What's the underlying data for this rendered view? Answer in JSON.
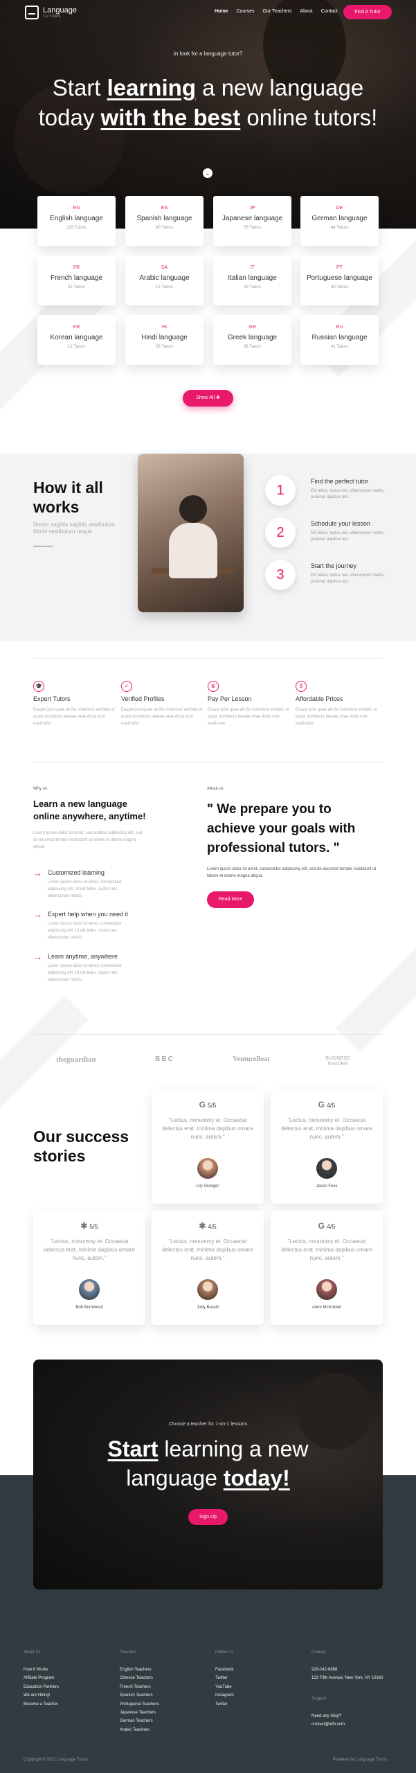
{
  "header": {
    "logo_title": "Language",
    "logo_subtitle": "TUTORS",
    "nav": [
      "Home",
      "Courses",
      "Our Teachers",
      "About",
      "Contact"
    ],
    "cta_label": "Find A Tutor"
  },
  "hero": {
    "kicker": "In look for a language tutor?",
    "title_1": "Start ",
    "title_bold_1": "learning",
    "title_2": " a new language today ",
    "title_bold_2": "with the best",
    "title_3": " online tutors!",
    "scroll_icon": "arrow-down-icon"
  },
  "languages": [
    {
      "code": "EN",
      "name": "English language",
      "count": "125 Tutors"
    },
    {
      "code": "ES",
      "name": "Spanish language",
      "count": "60 Tutors"
    },
    {
      "code": "JP",
      "name": "Japanese language",
      "count": "76 Tutors"
    },
    {
      "code": "DE",
      "name": "German language",
      "count": "44 Tutors"
    },
    {
      "code": "FR",
      "name": "French language",
      "count": "92 Tutors"
    },
    {
      "code": "SA",
      "name": "Arabic language",
      "count": "12 Tutors"
    },
    {
      "code": "IT",
      "name": "Italian language",
      "count": "40 Tutors"
    },
    {
      "code": "PT",
      "name": "Portuguese language",
      "count": "30 Tutors"
    },
    {
      "code": "KR",
      "name": "Korean language",
      "count": "12 Tutors"
    },
    {
      "code": "HI",
      "name": "Hindi language",
      "count": "28 Tutors"
    },
    {
      "code": "GR",
      "name": "Greek language",
      "count": "36 Tutors"
    },
    {
      "code": "RU",
      "name": "Russian language",
      "count": "41 Tutors"
    }
  ],
  "show_all": "Show All",
  "how": {
    "title": "How it all works",
    "subtitle": "Donec sagittis sagittis vestibulum. Morbi vestibulum neque",
    "steps": [
      {
        "num": "1",
        "title": "Find the perfect tutor",
        "text": "Elit tellus, luctus nec ullamcorper mattis, pulvinar dapibus leo."
      },
      {
        "num": "2",
        "title": "Schedule your lesson",
        "text": "Elit tellus, luctus nec ullamcorper mattis, pulvinar dapibus leo."
      },
      {
        "num": "3",
        "title": "Start the journey",
        "text": "Elit tellus, luctus nec ullamcorper mattis, pulvinar dapibus leo."
      }
    ]
  },
  "features": [
    {
      "icon": "graduation-icon",
      "glyph": "🎓",
      "title": "Expert Tutors",
      "text": "Eaque ipsa quae ab illo inventore veritatis et quasi architecto beatae vitae dicta sunt explicabo."
    },
    {
      "icon": "user-check-icon",
      "glyph": "✓",
      "title": "Verified Profiles",
      "text": "Eaque ipsa quae ab illo inventore veritatis et quasi architecto beatae vitae dicta sunt explicabo."
    },
    {
      "icon": "crown-icon",
      "glyph": "♛",
      "title": "Pay Per Lesson",
      "text": "Eaque ipsa quae ab illo inventore veritatis et quasi architecto beatae vitae dicta sunt explicabo."
    },
    {
      "icon": "dollar-icon",
      "glyph": "$",
      "title": "Affordable Prices",
      "text": "Eaque ipsa quae ab illo inventore veritatis et quasi architecto beatae vitae dicta sunt explicabo."
    }
  ],
  "why": {
    "label": "Why us",
    "title": "Learn a new language online anywhere, anytime!",
    "text": "Lorem ipsum dolor sit amet, consectetur adipiscing elit, sed do eiusmod tempor incididunt ut labore et dolore magna aliqua.",
    "items": [
      {
        "title": "Customized learning",
        "text": "Lorem ipsum dolor sit amet, consectetur adipiscing elit. Ut elit tellus, luctus nec ullamcorper mattis."
      },
      {
        "title": "Expert help when you need it",
        "text": "Lorem ipsum dolor sit amet, consectetur adipiscing elit. Ut elit tellus, luctus nec ullamcorper mattis."
      },
      {
        "title": "Learn anytime, anywhere",
        "text": "Lorem ipsum dolor sit amet, consectetur adipiscing elit. Ut elit tellus, luctus nec ullamcorper mattis."
      }
    ]
  },
  "about": {
    "label": "About us",
    "quote": "\" We prepare you to achieve your goals with professional tutors. \"",
    "text": "Lorem ipsum dolor sit amet, consectetur adipiscing elit, sed do eiusmod tempor incididunt ut labore et dolore magna aliqua.",
    "button": "Read More"
  },
  "press": [
    "theguardian",
    "BBC",
    "VentureBeat",
    "BUSINESS INSIDER"
  ],
  "stories": {
    "title": "Our success stories",
    "cards": [
      {
        "icon": "G",
        "rating": "5/5",
        "quote": "\"Lectus, nonummy et. Occaecat delectus erat, minima dapibus ornare nunc, autem.\"",
        "name": "Lily Granger",
        "avatar": "#c98a6c"
      },
      {
        "icon": "G",
        "rating": "4/5",
        "quote": "\"Lectus, nonummy et. Occaecat delectus erat, minima dapibus ornare nunc, autem.\"",
        "name": "Jason Foxx",
        "avatar": "#3d3f44"
      },
      {
        "icon": "✱",
        "rating": "5/5",
        "quote": "\"Lectus, nonummy et. Occaecat delectus erat, minima dapibus ornare nunc, autem.\"",
        "name": "Bob Burnwood",
        "avatar": "#6c87a5"
      },
      {
        "icon": "✱",
        "rating": "4/5",
        "quote": "\"Lectus, nonummy et. Occaecat delectus erat, minima dapibus ornare nunc, autem.\"",
        "name": "Judy Bassill",
        "avatar": "#b07a5e"
      },
      {
        "icon": "G",
        "rating": "4/5",
        "quote": "\"Lectus, nonummy et. Occaecat delectus erat, minima dapibus ornare nunc, autem.\"",
        "name": "Anne McKolden",
        "avatar": "#a45a5a"
      }
    ]
  },
  "cta": {
    "kicker": "Choose a teacher for 1-on-1 lessons",
    "title_bold_1": "Start",
    "title_2": " learning a new language ",
    "title_bold_2": "today!",
    "button": "Sign Up"
  },
  "footer": {
    "about": {
      "heading": "About Us",
      "items": [
        "How It Works",
        "Affiliate Program",
        "Education Partners",
        "We are Hiring!",
        "Become a Teacher"
      ]
    },
    "teachers": {
      "heading": "Teachers",
      "items": [
        "English Teachers",
        "Chinese Teachers",
        "French Teachers",
        "Spanish Teachers",
        "Portuguese Teachers",
        "Japanese Teachers",
        "German Teachers",
        "Arabic Teachers"
      ]
    },
    "follow": {
      "heading": "Follow Us",
      "items": [
        "Facebook",
        "Twitter",
        "YouTube",
        "Instagram",
        "Twitter"
      ]
    },
    "contact": {
      "heading": "Contact",
      "phone": "929-242-6868",
      "address": "123 Fifth Avenue, New York, NY 10160",
      "support_heading": "Support",
      "help": "Need any Help?",
      "email": "contact@info.com"
    },
    "copyright": "Copyright © 2022 Language Tutors",
    "powered": "Powered by Language Tutors"
  },
  "colors": {
    "accent": "#e8196a",
    "dark": "#323c40"
  }
}
